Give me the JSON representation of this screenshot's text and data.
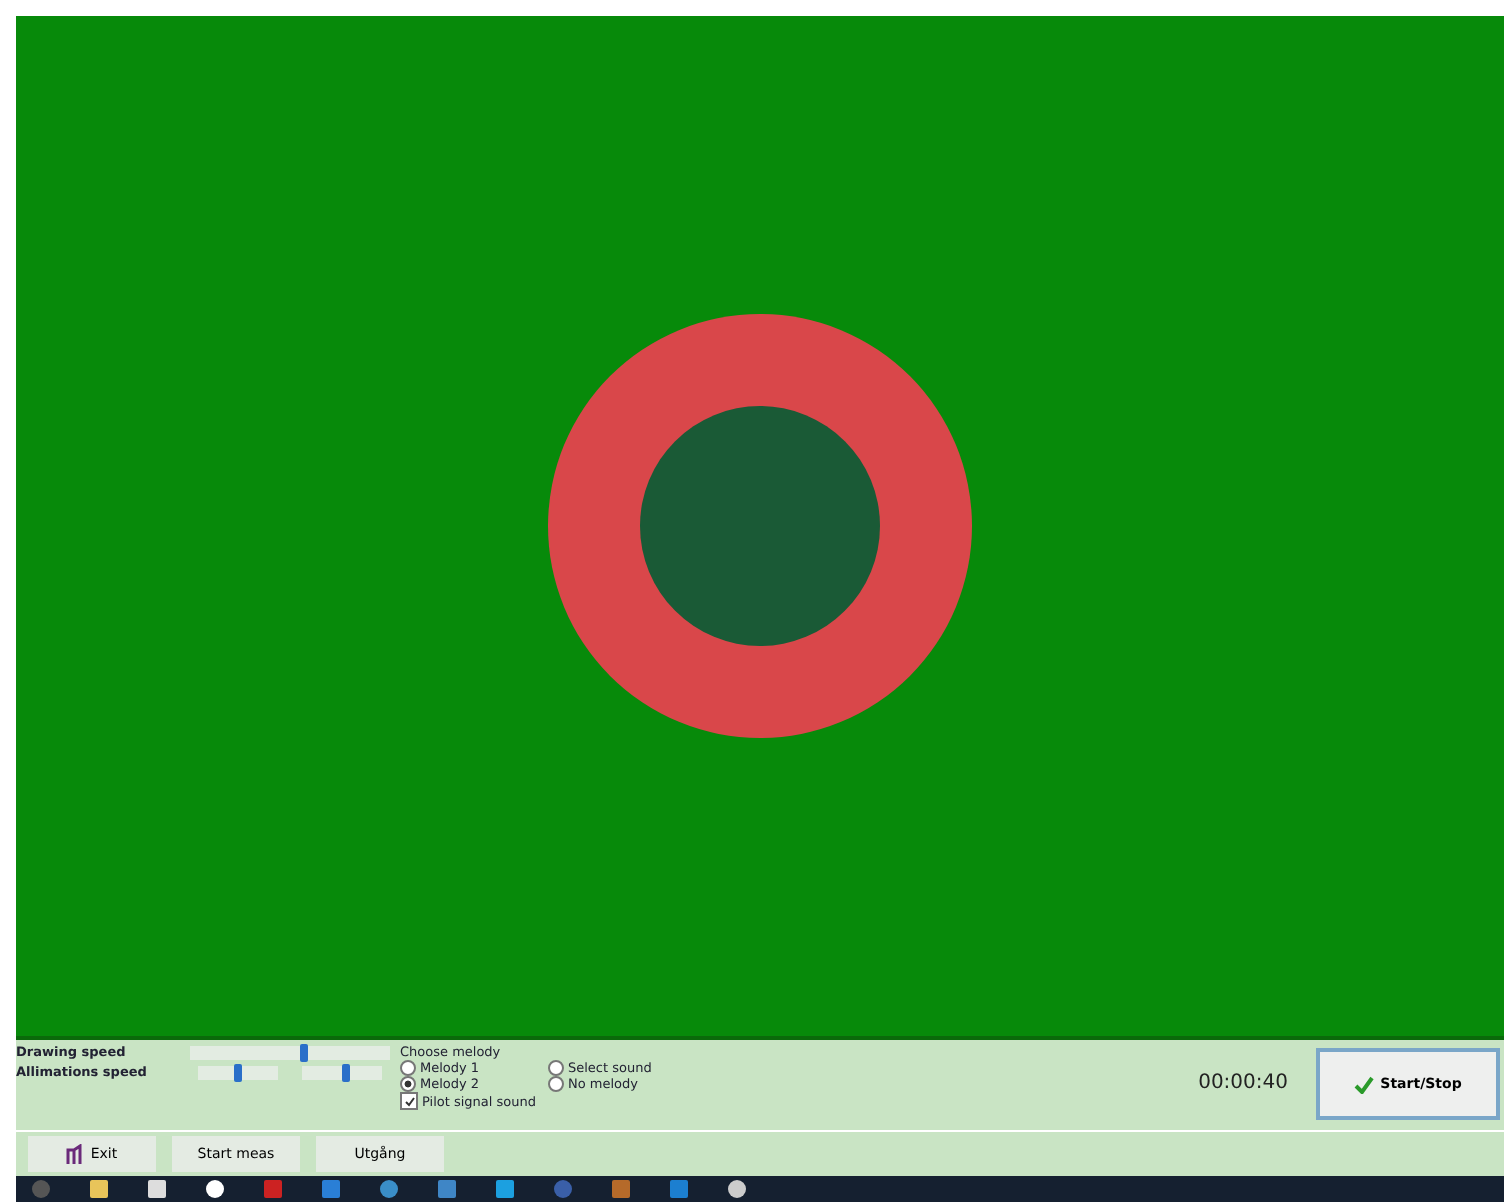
{
  "controls": {
    "sliders": [
      {
        "label": "Drawing speed",
        "tracks": [
          {
            "level": 0.57
          }
        ]
      },
      {
        "label": "Allimations speed",
        "tracks": [
          {
            "level": 0.5
          },
          {
            "level": 0.55
          }
        ]
      }
    ],
    "melody": {
      "title": "Choose melody",
      "options": [
        {
          "label": "Melody 1",
          "selected": false
        },
        {
          "label": "Select sound",
          "selected": false
        },
        {
          "label": "Melody 2",
          "selected": true
        },
        {
          "label": "No melody",
          "selected": false
        }
      ]
    },
    "pilot": {
      "label": "Pilot signal sound",
      "checked": true
    },
    "timer": "00:00:40",
    "start_stop": "Start/Stop"
  },
  "buttons": [
    {
      "label": "Exit",
      "kind": "exit"
    },
    {
      "label": "Start meas",
      "kind": "plain"
    },
    {
      "label": "Utgång",
      "kind": "plain"
    }
  ]
}
